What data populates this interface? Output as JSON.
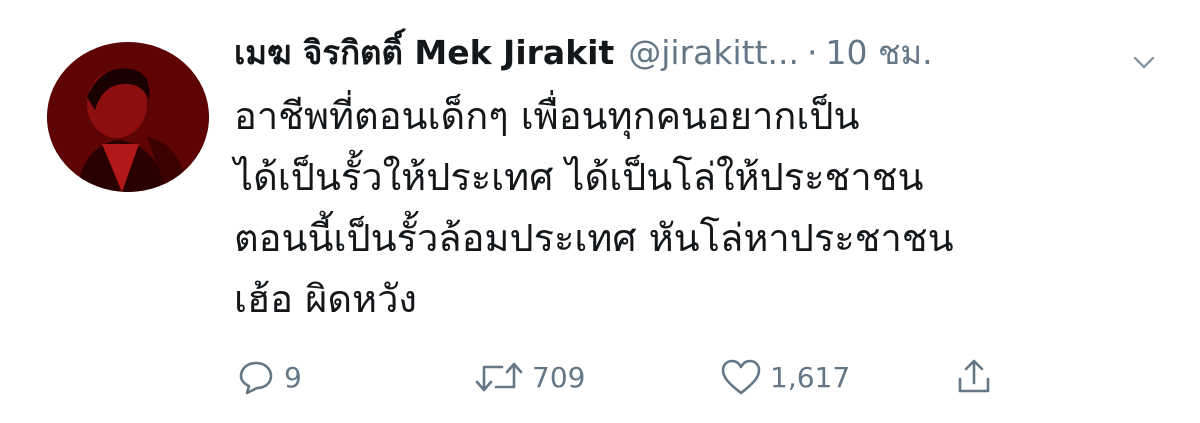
{
  "tweet": {
    "display_name": "เมฆ จิรกิตติ์ Mek Jirakit",
    "handle": "@jirakitt...",
    "separator": "·",
    "time": "10 ชม.",
    "body_lines": [
      "อาชีพที่ตอนเด็กๆ เพื่อนทุกคนอยากเป็น",
      "ได้เป็นรั้วให้ประเทศ ได้เป็นโล่ให้ประชาชน",
      "ตอนนี้เป็นรั้วล้อมประเทศ หันโล่หาประชาชน",
      "เฮ้อ ผิดหวัง"
    ],
    "avatar_alt": "profile photo (red toned)",
    "icons": {
      "more": "chevron-down-icon",
      "reply": "speech-bubble-icon",
      "retweet": "retweet-arrows-icon",
      "like": "heart-icon",
      "share": "share-upload-icon"
    }
  },
  "actions": {
    "reply_count": "9",
    "retweet_count": "709",
    "like_count": "1,617"
  },
  "colors": {
    "text_primary": "#14171a",
    "text_secondary": "#657786",
    "avatar_red": "#9b1111"
  }
}
